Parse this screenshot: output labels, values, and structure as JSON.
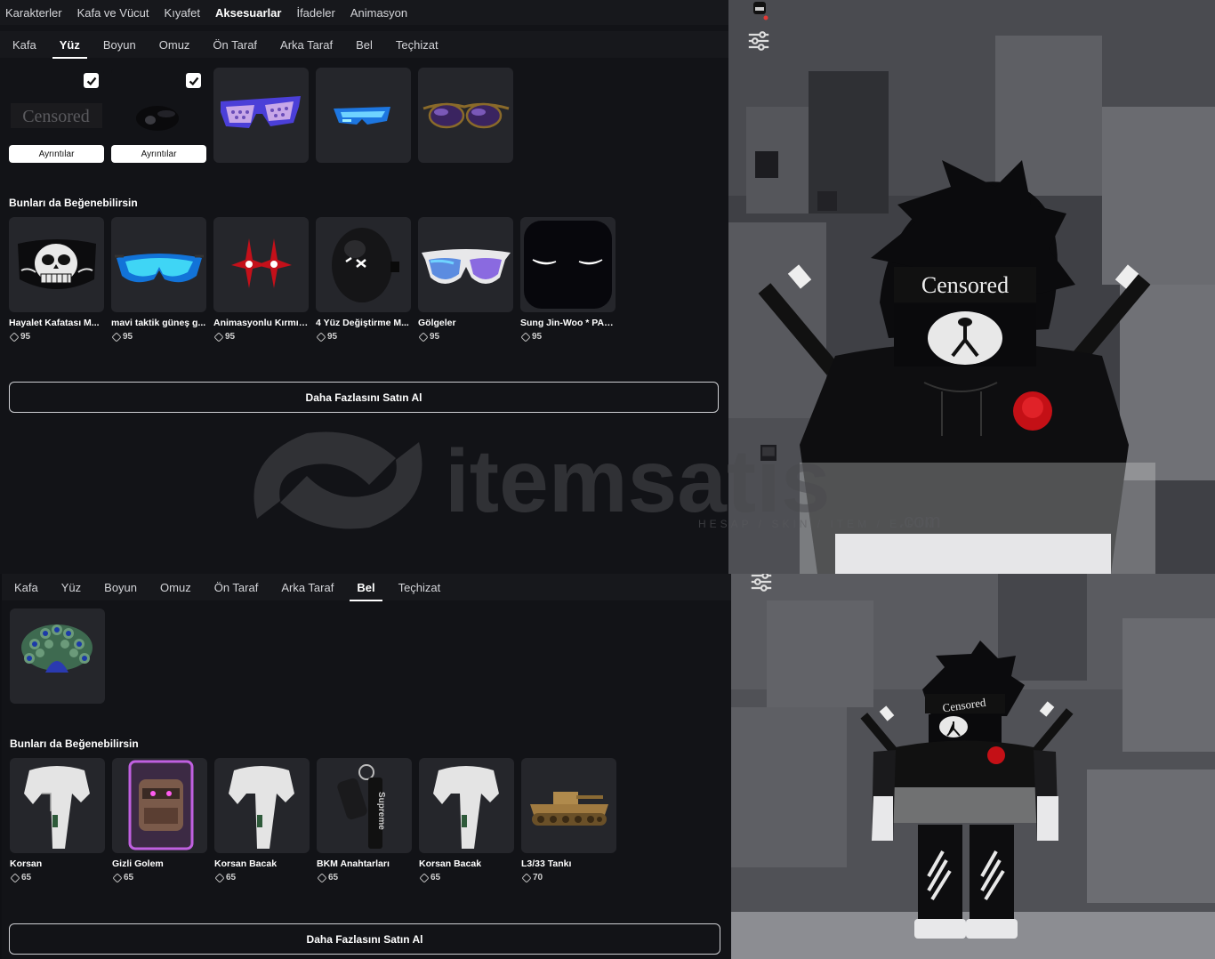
{
  "top_nav": [
    "Karakterler",
    "Kafa ve Vücut",
    "Kıyafet",
    "Aksesuarlar",
    "İfadeler",
    "Animasyon"
  ],
  "top_nav_active": "Aksesuarlar",
  "top_panel": {
    "subtabs": [
      "Kafa",
      "Yüz",
      "Boyun",
      "Omuz",
      "Ön Taraf",
      "Arka Taraf",
      "Bel",
      "Teçhizat"
    ],
    "active_subtab": "Yüz",
    "worn": [
      {
        "label": "Censored",
        "details": "Ayrıntılar"
      },
      {
        "label": "",
        "details": "Ayrıntılar"
      }
    ],
    "section_title": "Bunları da Beğenebilirsin",
    "recommended": [
      {
        "name": "Hayalet Kafatası M...",
        "price": "95"
      },
      {
        "name": "mavi taktik güneş g...",
        "price": "95"
      },
      {
        "name": "Animasyonlu Kırmız...",
        "price": "95"
      },
      {
        "name": "4 Yüz Değiştirme M...",
        "price": "95"
      },
      {
        "name": "Gölgeler",
        "price": "95"
      },
      {
        "name": "Sung Jin-Woo * PAR...",
        "price": "95"
      }
    ],
    "buy_more": "Daha Fazlasını Satın Al"
  },
  "bottom_panel": {
    "subtabs": [
      "Kafa",
      "Yüz",
      "Boyun",
      "Omuz",
      "Ön Taraf",
      "Arka Taraf",
      "Bel",
      "Teçhizat"
    ],
    "active_subtab": "Bel",
    "section_title": "Bunları da Beğenebilirsin",
    "recommended": [
      {
        "name": "Korsan",
        "price": "65"
      },
      {
        "name": "Gizli Golem",
        "price": "65"
      },
      {
        "name": "Korsan Bacak",
        "price": "65"
      },
      {
        "name": "BKM Anahtarları",
        "price": "65"
      },
      {
        "name": "Korsan Bacak",
        "price": "65"
      },
      {
        "name": "L3/33 Tankı",
        "price": "70"
      }
    ],
    "buy_more": "Daha Fazlasını Satın Al"
  },
  "avatar": {
    "mask_text_top": "Censored",
    "mask_text_bottom": "Censored",
    "brand_text": "Supreme"
  },
  "watermark": {
    "brand": "itemsatis",
    "tagline": "HESAP / SKIN / ITEM / E-PIN",
    "suffix": ".com"
  },
  "icons": {
    "settings": "sliders-icon",
    "currency": "robux-icon",
    "check": "check-icon"
  },
  "colors": {
    "panel_bg": "#121317",
    "tile_bg": "#25262b",
    "accent_white": "#ffffff"
  }
}
